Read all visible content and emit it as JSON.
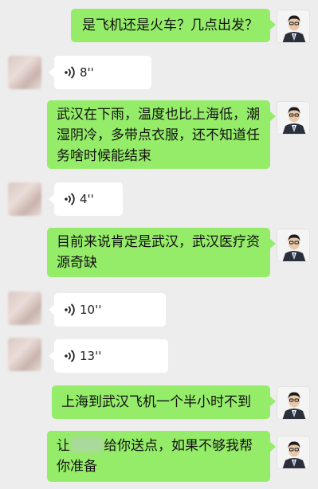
{
  "conversation": {
    "messages": [
      {
        "side": "me",
        "type": "text",
        "text": "是飞机还是火车？几点出发？"
      },
      {
        "side": "other",
        "type": "voice",
        "duration": "8''"
      },
      {
        "side": "me",
        "type": "text",
        "text": "武汉在下雨，温度也比上海低，潮湿阴冷，多带点衣服，还不知道任务啥时候能结束"
      },
      {
        "side": "other",
        "type": "voice",
        "duration": "4''"
      },
      {
        "side": "me",
        "type": "text",
        "text": "目前来说肯定是武汉，武汉医疗资源奇缺"
      },
      {
        "side": "other",
        "type": "voice",
        "duration": "10''"
      },
      {
        "side": "other",
        "type": "voice",
        "duration": "13''"
      },
      {
        "side": "me",
        "type": "text",
        "text": "上海到武汉飞机一个半小时不到"
      },
      {
        "side": "me",
        "type": "text",
        "text_before": "让",
        "text_after": "给你送点，如果不够我帮你准备"
      }
    ]
  },
  "colors": {
    "my_bubble": "#95ec69",
    "other_bubble": "#ffffff",
    "background": "#ededed"
  },
  "icons": {
    "voice": "voice-wave-icon",
    "avatar_me": "avatar-man-in-suit"
  }
}
